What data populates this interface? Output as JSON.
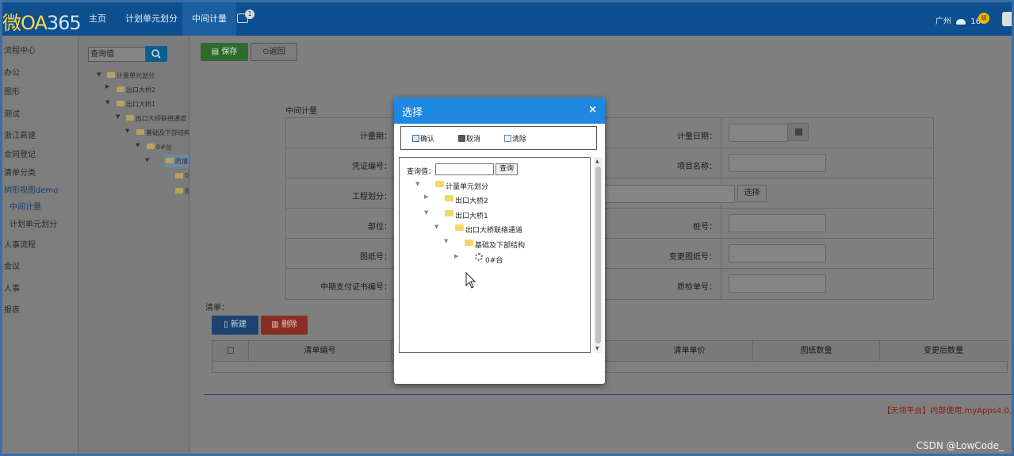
{
  "topbar": {
    "logo_main": "微OA",
    "logo_num": "365",
    "nav": [
      "主页",
      "计划单元划分",
      "中间计量"
    ],
    "badge": "1",
    "city": "广州",
    "temp": "16°",
    "weather_badge": "晴"
  },
  "leftnav": {
    "items": [
      "流程中心",
      "办公",
      "图形",
      "测试",
      "浙江高速",
      "合同登记",
      "清单分类",
      "树形视图demo",
      "中间计量",
      "计划单元划分",
      "人事流程",
      "会议",
      "人事",
      "报表"
    ]
  },
  "tree": {
    "search_value": "查询值",
    "nodes": [
      "计量单元划分",
      "出口大桥2",
      "出口大桥1",
      "出口大桥联络通道",
      "基础及下部结构",
      "0#台",
      "防撞",
      "0",
      "图"
    ]
  },
  "toolbar": {
    "save_label": "保存",
    "back_label": "返回"
  },
  "form": {
    "title": "中间计量",
    "labels_left": [
      "计量期：",
      "凭证编号：",
      "工程划分：",
      "部位：",
      "图纸号：",
      "中期支付证书编号："
    ],
    "labels_right": [
      "计量日期：",
      "项目名称：",
      "桩号：",
      "变更图纸号：",
      "质检单号："
    ],
    "select_label": "选择"
  },
  "list": {
    "label": "清单：",
    "new_label": "新建",
    "delete_label": "删除",
    "columns": [
      "清单编号",
      "清单单价",
      "图纸数量",
      "变更后数量"
    ]
  },
  "footer": {
    "text": "【天翎平台】内部使用,myApps4.0.",
    "watermark": "CSDN @LowCode_"
  },
  "modal": {
    "title": "选择",
    "close": "×",
    "confirm_label": "确认",
    "cancel_label": "取消",
    "clear_label": "清除",
    "query_label": "查询值：",
    "query_button": "查询",
    "nodes": [
      "计量单元划分",
      "出口大桥2",
      "出口大桥1",
      "出口大桥联络通道",
      "基础及下部结构",
      "0#台"
    ]
  },
  "colors": {
    "accent": "#1e87e0",
    "topbar": "#0d4f8f",
    "save": "#2f6b2f",
    "delete": "#8a2e23"
  }
}
